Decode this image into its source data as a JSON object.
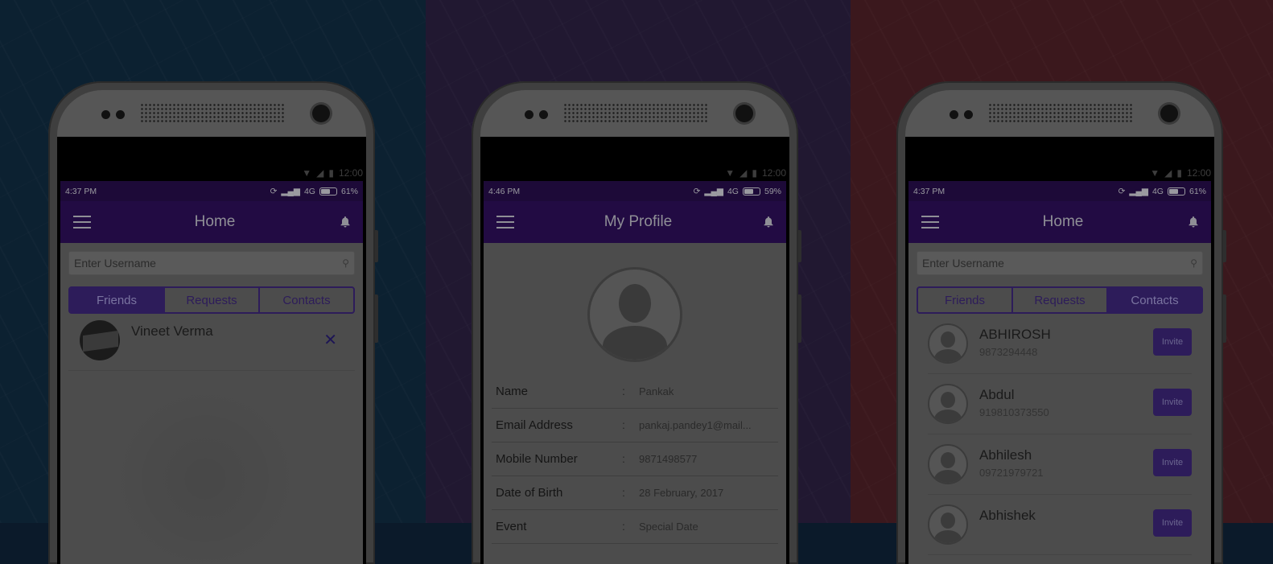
{
  "colors": {
    "left_bg": "#0c2131",
    "middle_bg": "#211831",
    "right_bg": "#3b181d",
    "app_bar": "#220b43",
    "accent": "#2d1c5a"
  },
  "phone_top_status": {
    "time": "12:00"
  },
  "phones": [
    {
      "status": {
        "time": "4:37 PM",
        "network": "4G",
        "battery": "61%"
      },
      "title": "Home",
      "search_placeholder": "Enter Username",
      "tabs": [
        {
          "label": "Friends",
          "active": true
        },
        {
          "label": "Requests",
          "active": false
        },
        {
          "label": "Contacts",
          "active": false
        }
      ],
      "friends": [
        {
          "name": "Vineet Verma",
          "remove_icon": "close-icon"
        }
      ]
    },
    {
      "status": {
        "time": "4:46 PM",
        "network": "4G",
        "battery": "59%"
      },
      "title": "My Profile",
      "fields": [
        {
          "label": "Name",
          "value": "Pankak"
        },
        {
          "label": "Email Address",
          "value": "pankaj.pandey1@mail..."
        },
        {
          "label": "Mobile Number",
          "value": "9871498577"
        },
        {
          "label": "Date of Birth",
          "value": "28 February, 2017"
        },
        {
          "label": "Event",
          "value": "Special Date"
        }
      ],
      "separator": ":"
    },
    {
      "status": {
        "time": "4:37 PM",
        "network": "4G",
        "battery": "61%"
      },
      "title": "Home",
      "search_placeholder": "Enter Username",
      "tabs": [
        {
          "label": "Friends",
          "active": false
        },
        {
          "label": "Requests",
          "active": false
        },
        {
          "label": "Contacts",
          "active": true
        }
      ],
      "contacts": [
        {
          "name": "ABHIROSH",
          "number": "9873294448",
          "action": "Invite"
        },
        {
          "name": "Abdul",
          "number": " 919810373550",
          "action": "Invite"
        },
        {
          "name": "Abhilesh",
          "number": "09721979721",
          "action": "Invite"
        },
        {
          "name": "Abhishek",
          "number": "",
          "action": "Invite"
        }
      ]
    }
  ]
}
